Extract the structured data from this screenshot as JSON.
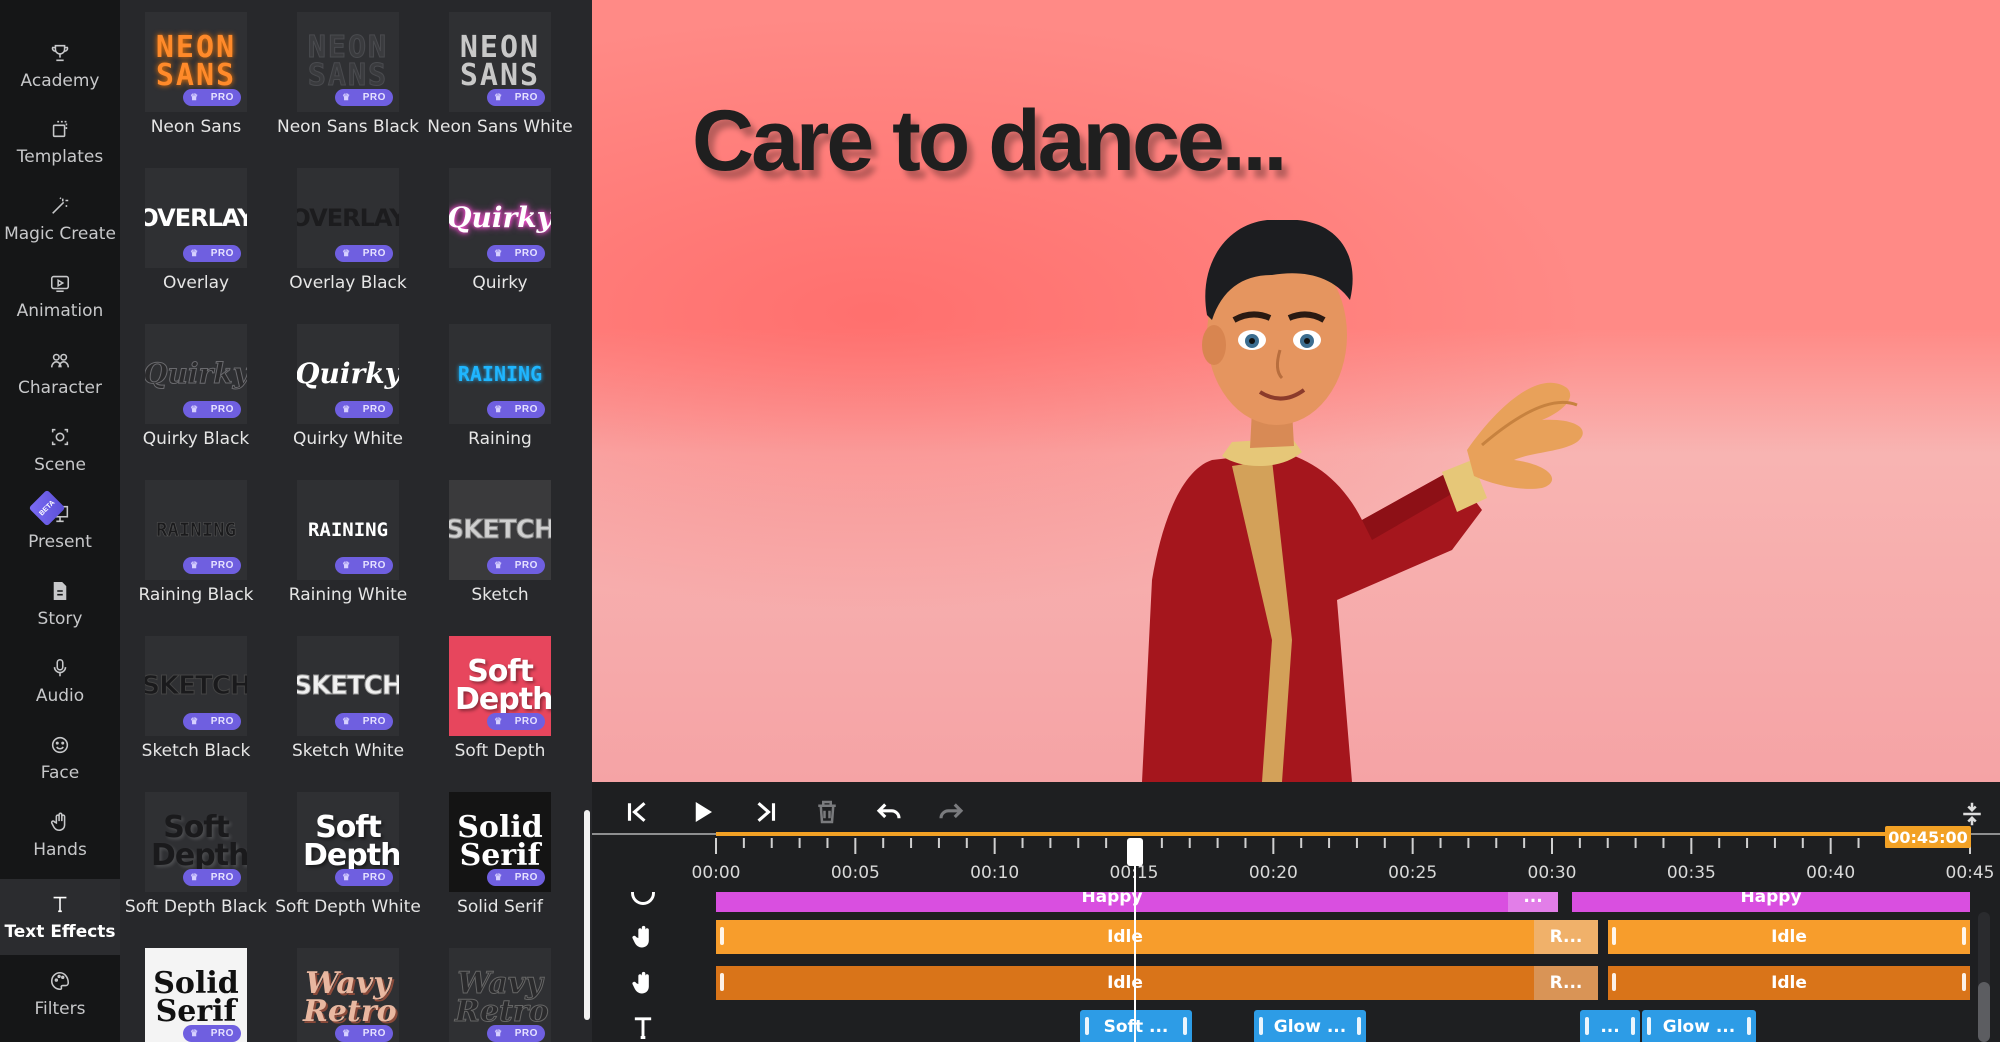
{
  "nav": {
    "items": [
      {
        "label": "Academy",
        "icon": "trophy-icon"
      },
      {
        "label": "Templates",
        "icon": "templates-icon"
      },
      {
        "label": "Magic Create",
        "icon": "magic-wand-icon"
      },
      {
        "label": "Animation",
        "icon": "animation-icon"
      },
      {
        "label": "Character",
        "icon": "characters-icon"
      },
      {
        "label": "Scene",
        "icon": "scene-icon"
      },
      {
        "label": "Present",
        "icon": "presentation-icon",
        "badge": "BETA"
      },
      {
        "label": "Story",
        "icon": "document-icon"
      },
      {
        "label": "Audio",
        "icon": "microphone-icon"
      },
      {
        "label": "Face",
        "icon": "smiley-icon"
      },
      {
        "label": "Hands",
        "icon": "hand-icon"
      },
      {
        "label": "Text Effects",
        "icon": "text-t-icon",
        "active": true
      },
      {
        "label": "Filters",
        "icon": "palette-icon"
      }
    ]
  },
  "effects": {
    "pro_label": "PRO",
    "items": [
      {
        "label": "Neon Sans",
        "preview": "NEON SANS"
      },
      {
        "label": "Neon Sans Black",
        "preview": "NEON SANS"
      },
      {
        "label": "Neon Sans White",
        "preview": "NEON SANS"
      },
      {
        "label": "Overlay",
        "preview": "OVERLAY"
      },
      {
        "label": "Overlay Black",
        "preview": "OVERLAY"
      },
      {
        "label": "Quirky",
        "preview": "Quirky"
      },
      {
        "label": "Quirky Black",
        "preview": "Quirky"
      },
      {
        "label": "Quirky White",
        "preview": "Quirky"
      },
      {
        "label": "Raining",
        "preview": "RAINING"
      },
      {
        "label": "Raining Black",
        "preview": "RAINING"
      },
      {
        "label": "Raining White",
        "preview": "RAINING"
      },
      {
        "label": "Sketch",
        "preview": "SKETCH"
      },
      {
        "label": "Sketch Black",
        "preview": "SKETCH"
      },
      {
        "label": "Sketch White",
        "preview": "SKETCH"
      },
      {
        "label": "Soft Depth",
        "preview": "Soft Depth"
      },
      {
        "label": "Soft Depth Black",
        "preview": "Soft Depth"
      },
      {
        "label": "Soft Depth White",
        "preview": "Soft Depth"
      },
      {
        "label": "Solid Serif",
        "preview": "Solid Serif"
      },
      {
        "label": "",
        "preview": "Solid Serif"
      },
      {
        "label": "",
        "preview": "Wavy Retro"
      },
      {
        "label": "",
        "preview": "Wavy Retro"
      }
    ]
  },
  "stage": {
    "text": "Care to dance..."
  },
  "timeline": {
    "end_time": "00:45:00",
    "ticks": [
      "00:00",
      "00:05",
      "00:10",
      "00:15",
      "00:20",
      "00:25",
      "00:30",
      "00:35",
      "00:40",
      "00:45"
    ],
    "tracks": {
      "emotion": [
        {
          "label": "Happy"
        },
        {
          "label": "..."
        },
        {
          "label": "Happy"
        }
      ],
      "left_hand": [
        {
          "label": "Idle"
        },
        {
          "label": "R..."
        },
        {
          "label": "Idle"
        }
      ],
      "right_hand": [
        {
          "label": "Idle"
        },
        {
          "label": "R..."
        },
        {
          "label": "Idle"
        }
      ],
      "text": [
        {
          "label": "Soft ..."
        },
        {
          "label": "Glow ..."
        },
        {
          "label": "..."
        },
        {
          "label": "Glow ..."
        }
      ]
    }
  },
  "colors": {
    "accent": "#f2a125",
    "pro_badge": "#6f5fe0",
    "emotion_track": "#d94fe0",
    "hand_track_1": "#f79d2c",
    "hand_track_2": "#d97419",
    "text_track": "#2d9ce6"
  }
}
